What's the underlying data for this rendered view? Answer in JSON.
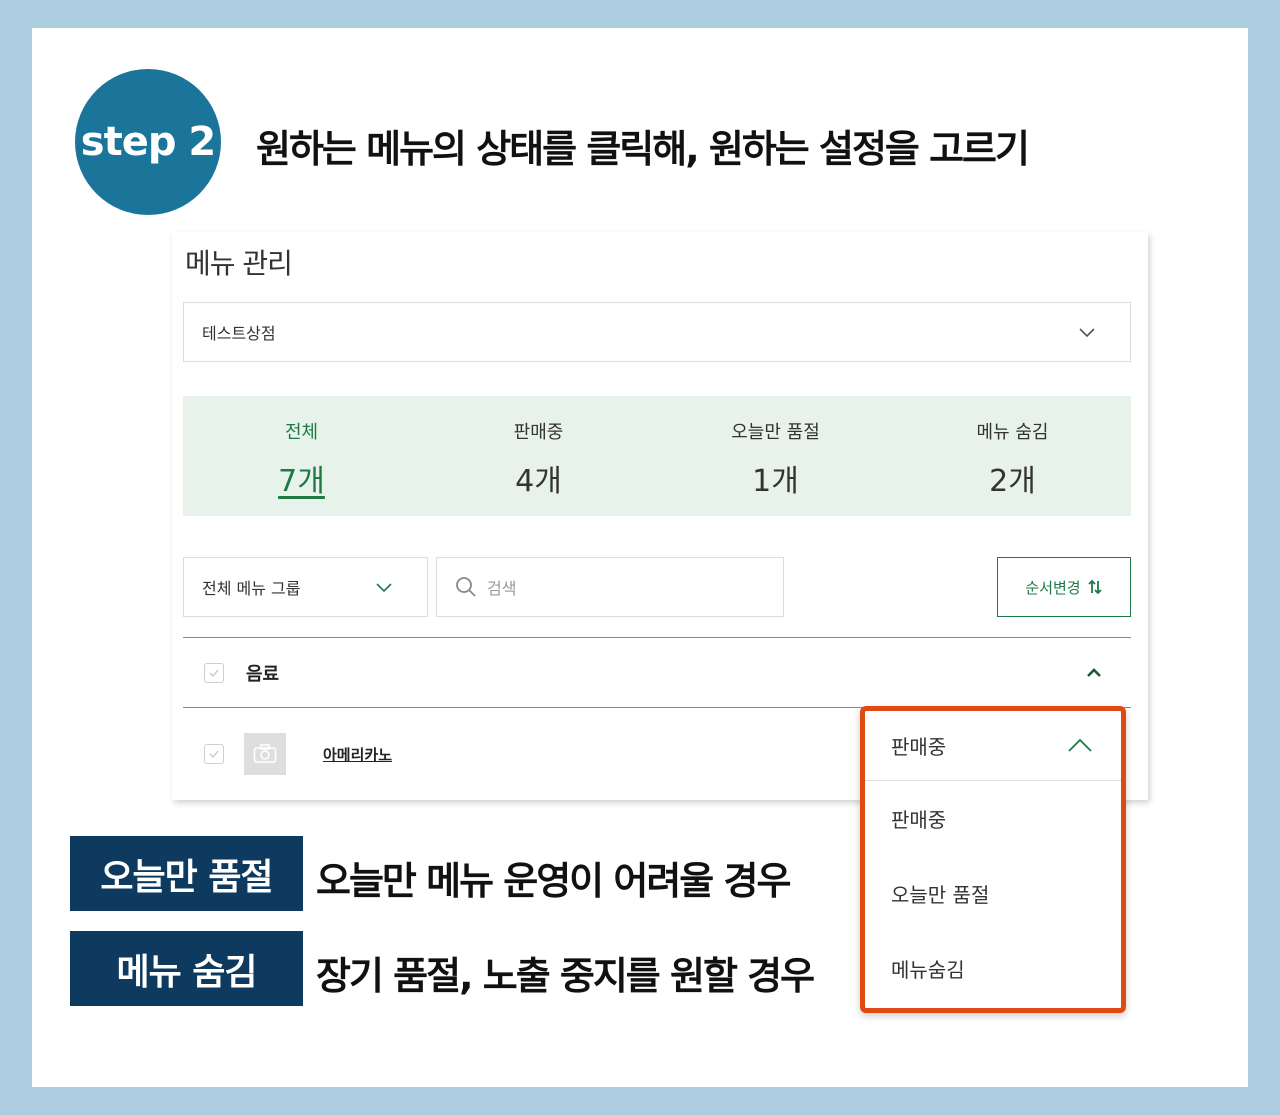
{
  "header": {
    "step_label": "step 2",
    "title": "원하는 메뉴의 상태를 클릭해, 원하는 설정을 고르기"
  },
  "panel": {
    "title": "메뉴 관리",
    "store_select": {
      "value": "테스트상점",
      "icon": "chevron-down-icon"
    },
    "stats": [
      {
        "label": "전체",
        "count": "7개",
        "active": true
      },
      {
        "label": "판매중",
        "count": "4개",
        "active": false
      },
      {
        "label": "오늘만 품절",
        "count": "1개",
        "active": false
      },
      {
        "label": "메뉴 숨김",
        "count": "2개",
        "active": false
      }
    ],
    "group_select": {
      "value": "전체 메뉴 그룹",
      "icon": "chevron-down-icon"
    },
    "search": {
      "placeholder": "검색",
      "icon": "search-icon"
    },
    "order_button": {
      "label": "순서변경",
      "icon": "sort-arrows-icon"
    },
    "group_row": {
      "name": "음료",
      "icon": "chevron-up-icon"
    },
    "menu_row": {
      "name": "아메리카노",
      "icon": "camera-icon"
    }
  },
  "status_dropdown": {
    "selected": "판매중",
    "options": [
      "판매중",
      "오늘만 품절",
      "메뉴숨김"
    ]
  },
  "legend": [
    {
      "tag": "오늘만 품절",
      "text": "오늘만 메뉴 운영이 어려울 경우"
    },
    {
      "tag": "메뉴 숨김",
      "text": "장기 품절, 노출 중지를 원할 경우"
    }
  ],
  "colors": {
    "background": "#adcde0",
    "badge": "#1b759b",
    "accent_green": "#1e7a45",
    "stats_bg": "#e6f2ea",
    "highlight_border": "#e04a12",
    "legend_tag_bg": "#0d3a5e"
  }
}
